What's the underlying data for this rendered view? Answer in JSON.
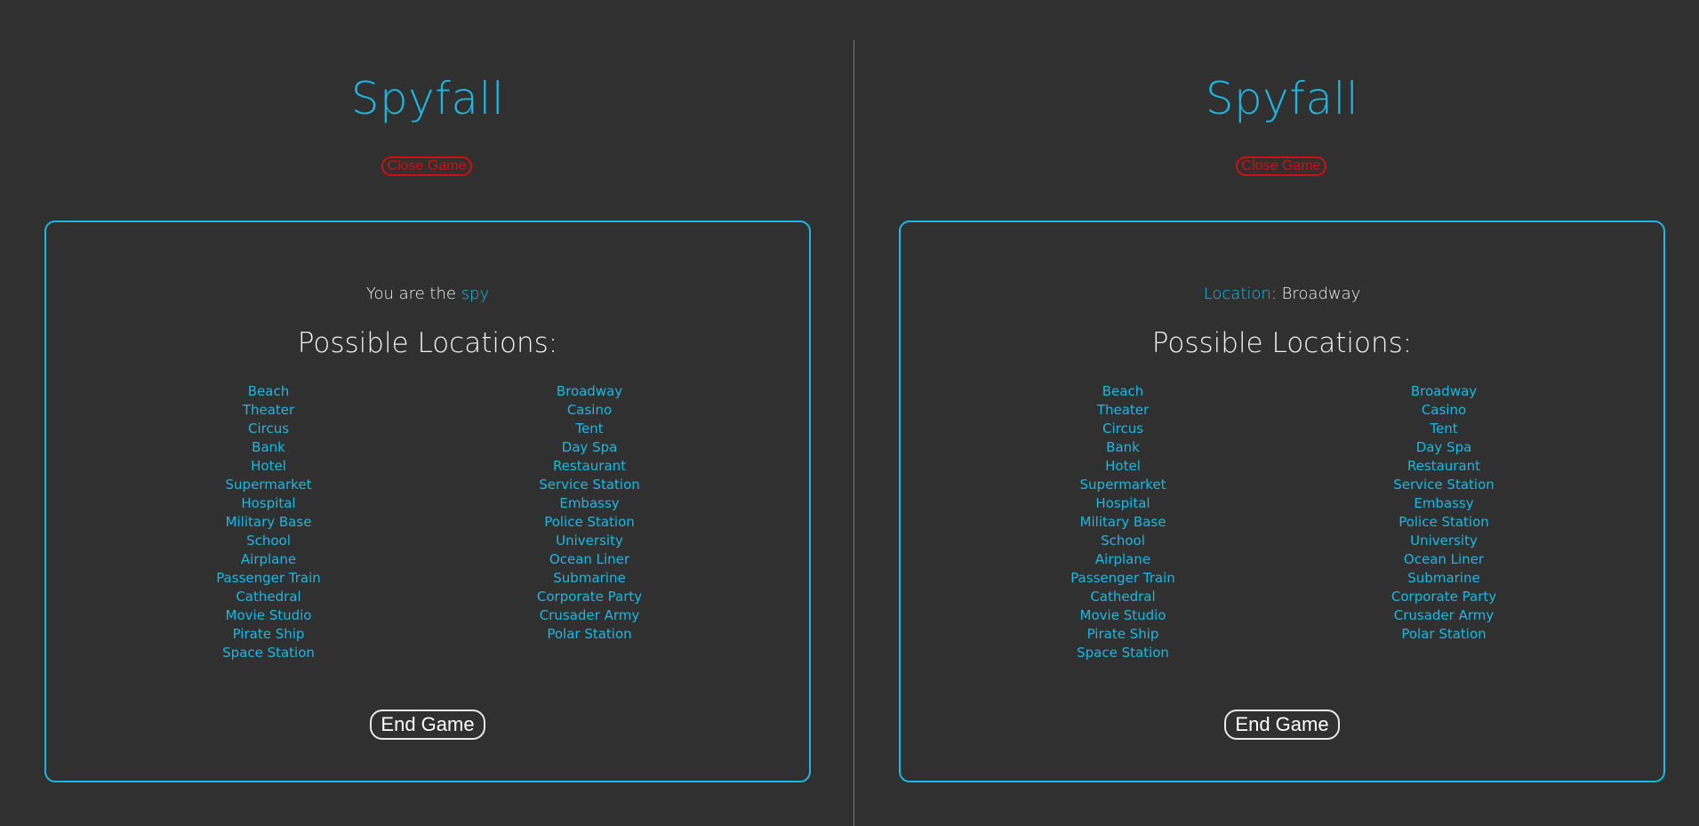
{
  "app": {
    "title": "Spyfall",
    "close_label": "Close Game",
    "end_label": "End Game",
    "heading": "Possible Locations:",
    "colors": {
      "accent": "#1ab8e2",
      "danger": "#d01010",
      "background": "#303030"
    }
  },
  "left": {
    "role_prefix": "You are the ",
    "role_value": "spy"
  },
  "right": {
    "location_label": "Location",
    "location_sep": ": ",
    "location_value": "Broadway"
  },
  "locations": {
    "col1": [
      "Beach",
      "Theater",
      "Circus",
      "Bank",
      "Hotel",
      "Supermarket",
      "Hospital",
      "Military Base",
      "School",
      "Airplane",
      "Passenger Train",
      "Cathedral",
      "Movie Studio",
      "Pirate Ship",
      "Space Station"
    ],
    "col2": [
      "Broadway",
      "Casino",
      "Tent",
      "Day Spa",
      "Restaurant",
      "Service Station",
      "Embassy",
      "Police Station",
      "University",
      "Ocean Liner",
      "Submarine",
      "Corporate Party",
      "Crusader Army",
      "Polar Station"
    ]
  }
}
